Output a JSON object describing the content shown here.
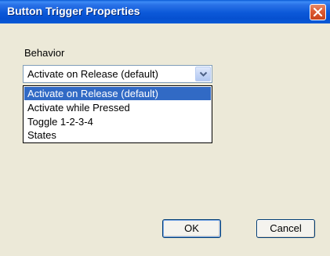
{
  "window": {
    "title": "Button Trigger Properties",
    "close_icon": "close-icon"
  },
  "behavior": {
    "label": "Behavior",
    "selected_value": "Activate on Release (default)",
    "options": [
      "Activate on Release (default)",
      "Activate while Pressed",
      "Toggle 1-2-3-4",
      "States"
    ],
    "highlighted_index": 0
  },
  "buttons": {
    "ok_label": "OK",
    "cancel_label": "Cancel"
  },
  "colors": {
    "titlebar": "#0a5bd6",
    "selection": "#316ac5",
    "dialog_bg": "#ece9d8",
    "close_button": "#dd5a32"
  }
}
